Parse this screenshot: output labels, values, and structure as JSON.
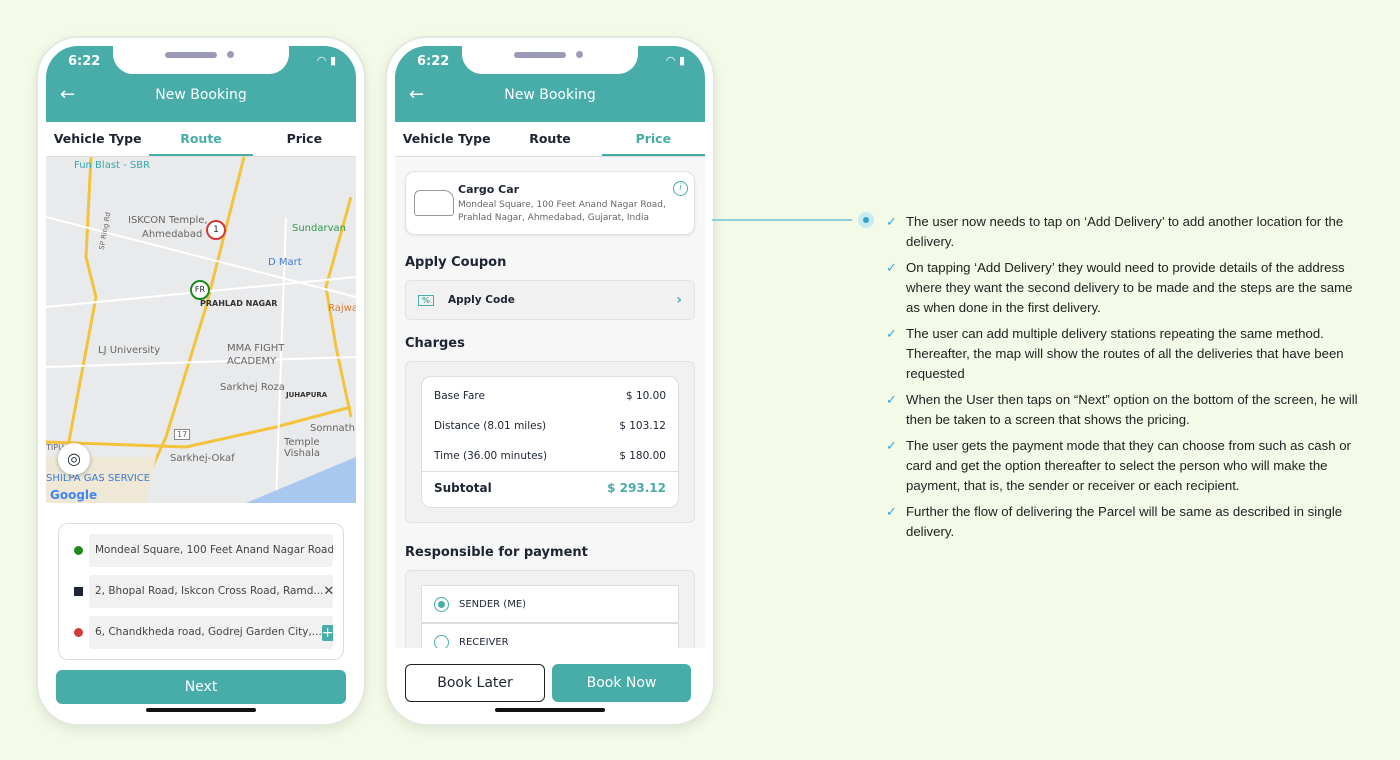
{
  "status": {
    "time": "6:22"
  },
  "header": {
    "title": "New Booking",
    "back_icon": "arrow-left-icon"
  },
  "tabs": [
    "Vehicle Type",
    "Route",
    "Price"
  ],
  "route_screen": {
    "active_tab": "Route",
    "map_labels": [
      "Fun Blast - SBR",
      "ISKCON Temple,",
      "Ahmedabad",
      "Sundarvan",
      "D Mart",
      "PRAHLAD NAGAR",
      "Rajwa",
      "LJ University",
      "MMA FIGHT",
      "ACADEMY",
      "Sarkhej Roza",
      "JUHAPURA",
      "Somnath",
      "Temple Vishala",
      "Sarkhej-Okaf",
      "SHILPA GAS SERVICE",
      "TIPU",
      "SP Ring Rd",
      "17",
      "Google"
    ],
    "markers": [
      "1",
      "FR"
    ],
    "stops": [
      {
        "text": "Mondeal Square, 100 Feet Anand Nagar Road...",
        "color": "#1e8a1e",
        "action": ""
      },
      {
        "text": "2, Bhopal Road, Iskcon Cross Road, Ramd...",
        "color": "#1d2433",
        "action": "✕"
      },
      {
        "text": "6, Chandkheda road, Godrej Garden City,...",
        "color": "#d23a3a",
        "action": "+"
      }
    ],
    "next_label": "Next"
  },
  "price_screen": {
    "active_tab": "Price",
    "vehicle": {
      "name": "Cargo Car",
      "address_line1": "Mondeal Square, 100 Feet Anand Nagar Road,",
      "address_line2": "Prahlad Nagar, Ahmedabad, Gujarat, India"
    },
    "coupon_heading": "Apply Coupon",
    "coupon_label": "Apply Code",
    "charges_heading": "Charges",
    "charges": [
      {
        "label": "Base Fare",
        "value": "$ 10.00"
      },
      {
        "label": "Distance (8.01 miles)",
        "value": "$ 103.12"
      },
      {
        "label": "Time (36.00 minutes)",
        "value": "$ 180.00"
      }
    ],
    "subtotal": {
      "label": "Subtotal",
      "value": "$ 293.12"
    },
    "payment_heading": "Responsible for payment",
    "payment_options": [
      {
        "label": "SENDER (ME)",
        "selected": true
      },
      {
        "label": "RECEIVER",
        "selected": false
      }
    ],
    "book_later": "Book Later",
    "book_now": "Book Now"
  },
  "colors": {
    "accent": "#48ada9",
    "background": "#f3fbe8",
    "check": "#3aa6d8"
  },
  "notes": [
    "The user now needs to tap on ‘Add Delivery’ to add another location for the delivery.",
    "On tapping ‘Add Delivery’ they would need to provide details of the address where they want the second delivery to be made and the steps are the same as when done in the first delivery.",
    "The user can add multiple delivery stations repeating the same method. Thereafter, the map will show the routes of all the deliveries that have been requested",
    "When the User then taps on “Next” option on the bottom of the screen, he will then be taken to a screen that shows the pricing.",
    "The user gets the payment mode that they can choose from such as cash or card and get the option thereafter to select the person who will make the payment, that is, the sender or receiver or each recipient.",
    "Further the flow of delivering the Parcel will be same as described in single delivery."
  ]
}
